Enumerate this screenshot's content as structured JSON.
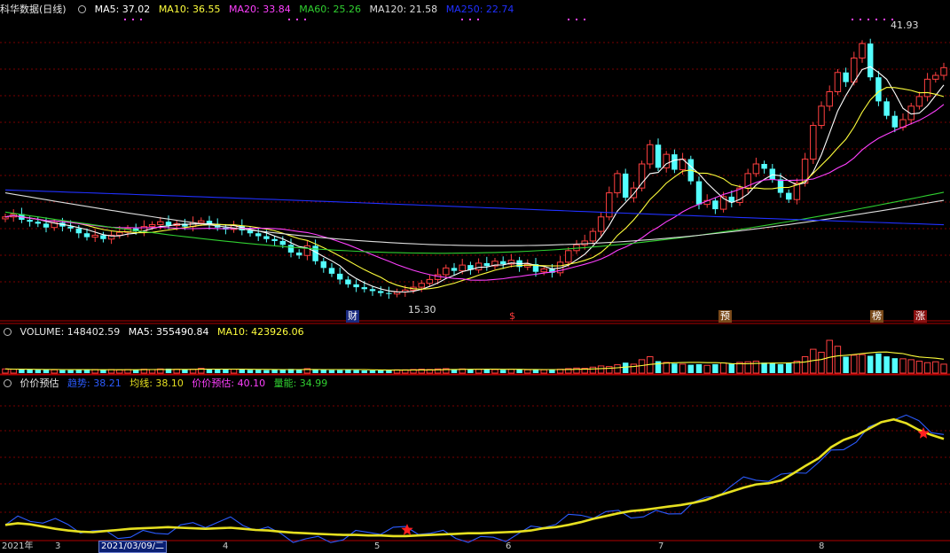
{
  "header_main": {
    "title": "科华数据(日线)",
    "ma5": "MA5: 37.02",
    "ma10": "MA10: 36.55",
    "ma20": "MA20: 33.84",
    "ma60": "MA60: 25.26",
    "ma120": "MA120: 21.58",
    "ma250": "MA250: 22.74"
  },
  "header_volume": {
    "volume": "VOLUME: 148402.59",
    "ma5": "MA5: 355490.84",
    "ma10": "MA10: 423926.06"
  },
  "header_indicator": {
    "name": "价价预估",
    "trend": "趋势: 38.21",
    "avg": "均线: 38.10",
    "forecast": "价价预估: 40.10",
    "energy": "量能: 34.99"
  },
  "annotations": {
    "high": "41.93",
    "low": "15.30"
  },
  "markers": [
    {
      "label": "财",
      "bg": "#1a2a80",
      "fg": "#ffffff"
    },
    {
      "label": "$",
      "bg": "#000000",
      "fg": "#ff3b3b"
    },
    {
      "label": "预",
      "bg": "#7a4a1a",
      "fg": "#ffffff"
    },
    {
      "label": "榜",
      "bg": "#7a4a1a",
      "fg": "#ffffff"
    },
    {
      "label": "涨",
      "bg": "#8a1010",
      "fg": "#ffffff"
    }
  ],
  "x_labels": [
    "2021年",
    "3",
    "2021/03/09/二",
    "4",
    "5",
    "6",
    "7",
    "8"
  ],
  "colors": {
    "up": "#ff4040",
    "down": "#54ffff",
    "ma5": "#ffffff",
    "ma10": "#ffff3c",
    "ma20": "#ff40ff",
    "ma60": "#30d030",
    "ma120": "#dddddd",
    "ma250": "#2030ff",
    "trend": "#2b5bff",
    "avg": "#e6e020",
    "grid": "#7a0000"
  },
  "chart_data": {
    "type": "candlestick",
    "date_range": [
      "2021",
      "2021-09"
    ],
    "price_range": [
      14,
      44
    ],
    "marked_high": 41.93,
    "marked_low": 15.3,
    "last": {
      "ma5": 37.02,
      "ma10": 36.55,
      "ma20": 33.84,
      "ma60": 25.26,
      "ma120": 21.58,
      "ma250": 22.74
    },
    "close": [
      23.5,
      23.8,
      23.2,
      23.0,
      22.8,
      22.4,
      22.9,
      22.5,
      22.3,
      21.8,
      21.4,
      21.6,
      21.2,
      21.6,
      21.9,
      22.3,
      22.0,
      22.5,
      22.7,
      23.0,
      22.6,
      22.8,
      22.5,
      22.9,
      23.1,
      22.7,
      22.4,
      22.2,
      22.6,
      22.1,
      21.8,
      21.5,
      21.2,
      21.0,
      20.6,
      19.8,
      19.5,
      20.5,
      18.9,
      18.2,
      17.6,
      17.0,
      16.5,
      16.2,
      16.0,
      15.8,
      15.6,
      15.5,
      15.7,
      15.9,
      16.2,
      16.6,
      17.0,
      17.5,
      18.2,
      17.9,
      18.5,
      18.0,
      18.7,
      18.4,
      18.9,
      18.6,
      19.0,
      18.3,
      18.6,
      17.8,
      18.1,
      17.7,
      18.8,
      20.0,
      20.6,
      21.0,
      22.0,
      23.5,
      26.0,
      28.0,
      25.5,
      26.5,
      29.0,
      31.0,
      28.6,
      30.0,
      28.4,
      29.5,
      27.2,
      24.8,
      25.2,
      24.3,
      25.6,
      25.0,
      26.5,
      28.0,
      29.0,
      28.5,
      27.4,
      26.0,
      25.3,
      27.0,
      29.5,
      33.0,
      35.0,
      36.5,
      38.5,
      37.5,
      40.0,
      41.5,
      38.0,
      35.5,
      34.0,
      32.8,
      33.6,
      35.0,
      36.0,
      37.8,
      38.2,
      39.0
    ],
    "volume": [
      14,
      13,
      12,
      12,
      11,
      12,
      11,
      10,
      10,
      11,
      13,
      12,
      11,
      12,
      11,
      12,
      11,
      13,
      12,
      14,
      15,
      13,
      12,
      13,
      16,
      14,
      12,
      12,
      13,
      12,
      11,
      11,
      10,
      11,
      12,
      14,
      13,
      15,
      12,
      11,
      10,
      10,
      11,
      10,
      9,
      9,
      10,
      10,
      11,
      11,
      12,
      13,
      12,
      14,
      15,
      13,
      14,
      12,
      13,
      12,
      12,
      11,
      13,
      12,
      11,
      12,
      11,
      12,
      13,
      15,
      17,
      16,
      20,
      24,
      22,
      28,
      35,
      30,
      45,
      55,
      40,
      36,
      32,
      30,
      28,
      30,
      26,
      30,
      34,
      32,
      36,
      38,
      40,
      35,
      34,
      30,
      34,
      40,
      55,
      80,
      70,
      110,
      90,
      55,
      60,
      62,
      58,
      66,
      56,
      50,
      48,
      45,
      40,
      35,
      38,
      30
    ],
    "indicator": {
      "trend_last": 38.21,
      "avg_last": 38.1,
      "forecast_last": 40.1,
      "energy_last": 34.99,
      "trend": [
        16.5,
        16.8,
        16.6,
        16.2,
        15.8,
        15.5,
        15.3,
        15.2,
        15.4,
        15.6,
        15.8,
        15.9,
        16.0,
        16.1,
        16.0,
        15.9,
        15.8,
        15.9,
        16.0,
        15.8,
        15.6,
        15.5,
        15.3,
        15.1,
        15.0,
        14.9,
        14.8,
        14.7,
        14.7,
        14.6,
        14.6,
        14.5,
        14.5,
        14.6,
        14.7,
        14.8,
        14.9,
        15.0,
        15.0,
        15.1,
        15.2,
        15.3,
        15.5,
        15.9,
        16.1,
        16.5,
        17.0,
        17.6,
        18.1,
        18.6,
        19.0,
        19.2,
        19.5,
        19.8,
        20.1,
        20.5,
        21.0,
        21.8,
        22.5,
        23.2,
        23.8,
        24.0,
        24.5,
        25.8,
        27.2,
        28.5,
        30.5,
        31.8,
        32.6,
        33.8,
        35.0,
        35.5,
        34.8,
        33.6,
        32.7,
        32.0
      ]
    }
  }
}
